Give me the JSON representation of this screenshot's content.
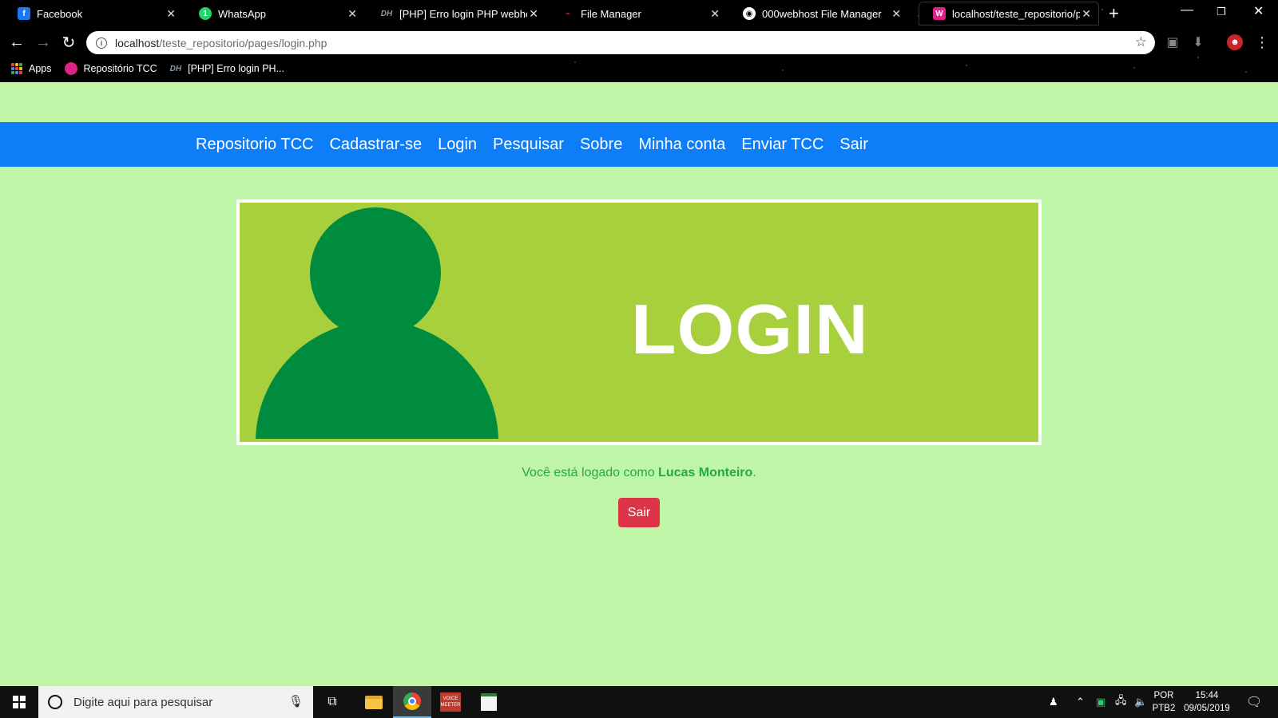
{
  "browser": {
    "tabs": [
      {
        "label": "Facebook",
        "icon": "facebook-icon",
        "color": "#1877f2"
      },
      {
        "label": "WhatsApp",
        "icon": "whatsapp-icon",
        "color": "#25d366"
      },
      {
        "label": "[PHP] Erro login PHP webhost",
        "icon": "dih-icon",
        "color": "#6b7b8c"
      },
      {
        "label": "File Manager",
        "icon": "file-manager-icon",
        "color": "#e2272e"
      },
      {
        "label": "000webhost File Manager",
        "icon": "globe-icon",
        "color": "#ffffff"
      },
      {
        "label": "localhost/teste_repositorio/pa",
        "icon": "wamp-icon",
        "color": "#e0218a"
      }
    ],
    "address": {
      "host": "localhost",
      "path": "/teste_repositorio/pages/login.php"
    },
    "bookmarks": [
      {
        "label": "Apps",
        "icon": "apps-grid-icon"
      },
      {
        "label": "Repositório TCC",
        "icon": "wamp-icon"
      },
      {
        "label": "[PHP] Erro login PH...",
        "icon": "dih-icon"
      }
    ]
  },
  "nav": {
    "links": [
      "Repositorio TCC",
      "Cadastrar-se",
      "Login",
      "Pesquisar",
      "Sobre",
      "Minha conta",
      "Enviar TCC",
      "Sair"
    ]
  },
  "banner": {
    "title": "LOGIN",
    "background": "#a8d03c",
    "avatar_color": "#008c3f"
  },
  "status": {
    "prefix": "Você está logado como ",
    "user": "Lucas Monteiro",
    "suffix": "."
  },
  "logout_button": {
    "label": "Sair",
    "color": "#dc3545"
  },
  "taskbar": {
    "search_placeholder": "Digite aqui para pesquisar",
    "language": {
      "line1": "POR",
      "line2": "PTB2"
    },
    "clock": {
      "time": "15:44",
      "date": "09/05/2019"
    }
  },
  "colors": {
    "page_bg": "#bff5a6",
    "navbar": "#0d7df8",
    "status_text": "#28a745"
  }
}
